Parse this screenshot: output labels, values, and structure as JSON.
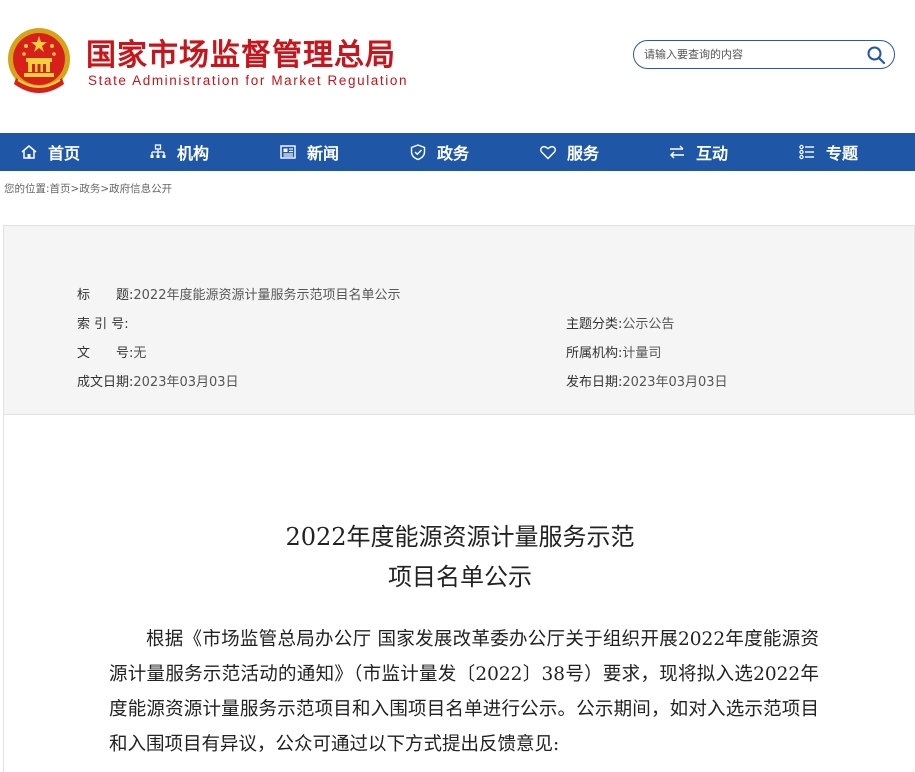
{
  "header": {
    "site_title_cn": "国家市场监督管理总局",
    "site_title_en": "State Administration for Market Regulation",
    "search_placeholder": "请输入要查询的内容",
    "brand_color": "#c8141b"
  },
  "nav": {
    "background": "#1f57a6",
    "items": [
      {
        "label": "首页",
        "icon": "home-icon"
      },
      {
        "label": "机构",
        "icon": "org-chart-icon"
      },
      {
        "label": "新闻",
        "icon": "newspaper-icon"
      },
      {
        "label": "政务",
        "icon": "shield-icon"
      },
      {
        "label": "服务",
        "icon": "heart-icon"
      },
      {
        "label": "互动",
        "icon": "exchange-arrows-icon"
      },
      {
        "label": "专题",
        "icon": "topics-list-icon"
      }
    ]
  },
  "breadcrumb": {
    "prefix": "您的位置:",
    "items": [
      "首页",
      "政务",
      "政府信息公开"
    ],
    "separator": ">"
  },
  "meta": {
    "title_label": "标　　题:",
    "title_value": "2022年度能源资源计量服务示范项目名单公示",
    "index_label": "索 引 号:",
    "index_value": "",
    "subject_label": "主题分类:",
    "subject_value": "公示公告",
    "docno_label": "文　　号:",
    "docno_value": "无",
    "agency_label": "所属机构:",
    "agency_value": "计量司",
    "created_label": "成文日期:",
    "created_value": "2023年03月03日",
    "published_label": "发布日期:",
    "published_value": "2023年03月03日"
  },
  "article": {
    "title_line1": "2022年度能源资源计量服务示范",
    "title_line2": "项目名单公示",
    "paragraph1": "根据《市场监管总局办公厅 国家发展改革委办公厅关于组织开展2022年度能源资源计量服务示范活动的通知》（市监计量发〔2022〕38号）要求，现将拟入选2022年度能源资源计量服务示范项目和入围项目名单进行公示。公示期间，如对入选示范项目和入围项目有异议，公众可通过以下方式提出反馈意见:"
  }
}
